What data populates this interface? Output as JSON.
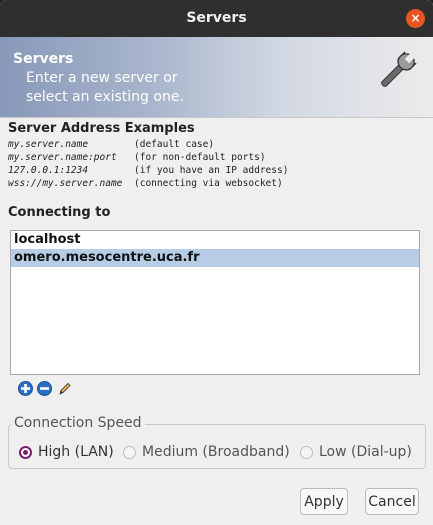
{
  "window": {
    "title": "Servers",
    "close_symbol": "×"
  },
  "banner": {
    "title": "Servers",
    "subtitle_line1": "Enter a new server or",
    "subtitle_line2": "select an existing one."
  },
  "examples": {
    "title": "Server Address Examples",
    "rows": [
      {
        "address": "my.server.name",
        "note": "(default case)"
      },
      {
        "address": "my.server.name:port",
        "note": "(for non-default ports)"
      },
      {
        "address": "127.0.0.1:1234",
        "note": "(if you have an IP address)"
      },
      {
        "address": "wss://my.server.name",
        "note": "(connecting via websocket)"
      }
    ]
  },
  "connecting": {
    "title": "Connecting to",
    "servers": [
      "localhost",
      "omero.mesocentre.uca.fr"
    ],
    "selected_index": 1
  },
  "speed": {
    "title": "Connection Speed",
    "options": [
      "High (LAN)",
      "Medium (Broadband)",
      "Low (Dial-up)"
    ],
    "selected": "High (LAN)"
  },
  "buttons": {
    "apply": "Apply",
    "cancel": "Cancel"
  },
  "colors": {
    "accent": "#e95420",
    "radio": "#77216f",
    "selection": "#b7cde6"
  }
}
